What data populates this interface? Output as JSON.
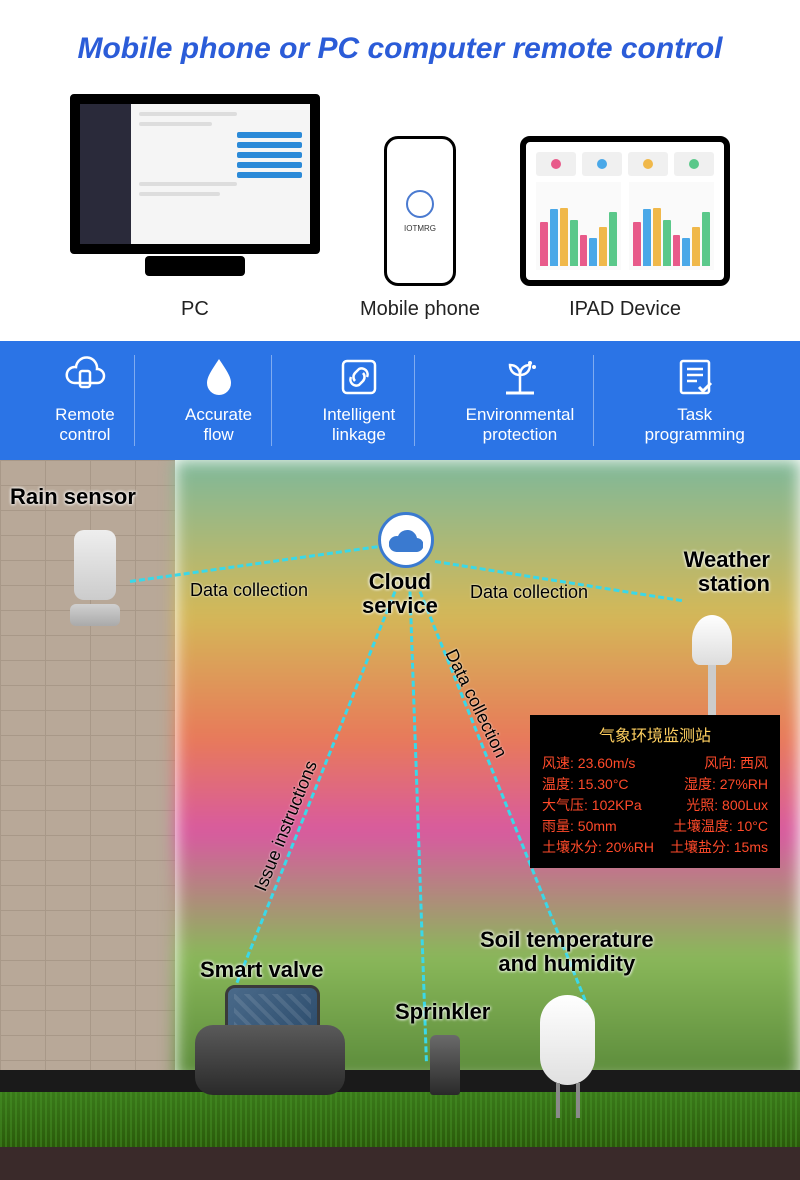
{
  "title": "Mobile phone or PC computer remote control",
  "devices": {
    "pc": "PC",
    "phone": "Mobile phone",
    "phone_brand": "IOTMRG",
    "ipad": "IPAD Device"
  },
  "features": [
    {
      "icon": "cloud-phone-icon",
      "line1": "Remote",
      "line2": "control"
    },
    {
      "icon": "droplet-icon",
      "line1": "Accurate",
      "line2": "flow"
    },
    {
      "icon": "link-icon",
      "line1": "Intelligent",
      "line2": "linkage"
    },
    {
      "icon": "plant-icon",
      "line1": "Environmental",
      "line2": "protection"
    },
    {
      "icon": "checklist-icon",
      "line1": "Task",
      "line2": "programming"
    }
  ],
  "scene": {
    "rain_sensor": "Rain sensor",
    "cloud_service": {
      "l1": "Cloud",
      "l2": "service"
    },
    "weather_station": {
      "l1": "Weather",
      "l2": "station"
    },
    "smart_valve": "Smart valve",
    "sprinkler": "Sprinkler",
    "soil_sensor": {
      "l1": "Soil temperature",
      "l2": "and humidity"
    },
    "flow_data_collection": "Data collection",
    "flow_issue": "Issue instructions"
  },
  "weather_panel": {
    "title": "气象环境监测站",
    "rows": [
      {
        "l": "风速:",
        "lv": "23.60m/s",
        "r": "风向:",
        "rv": "西风"
      },
      {
        "l": "温度:",
        "lv": "15.30°C",
        "r": "湿度:",
        "rv": "27%RH"
      },
      {
        "l": "大气压:",
        "lv": "102KPa",
        "r": "光照:",
        "rv": "800Lux"
      },
      {
        "l": "雨量:",
        "lv": "50mm",
        "r": "土壤温度:",
        "rv": "10°C"
      },
      {
        "l": "土壤水分:",
        "lv": "20%RH",
        "r": "土壤盐分:",
        "rv": "15ms"
      }
    ]
  },
  "ipad_colors": [
    "#e85a8a",
    "#4aa8e8",
    "#f0b84a",
    "#5ac88a"
  ]
}
